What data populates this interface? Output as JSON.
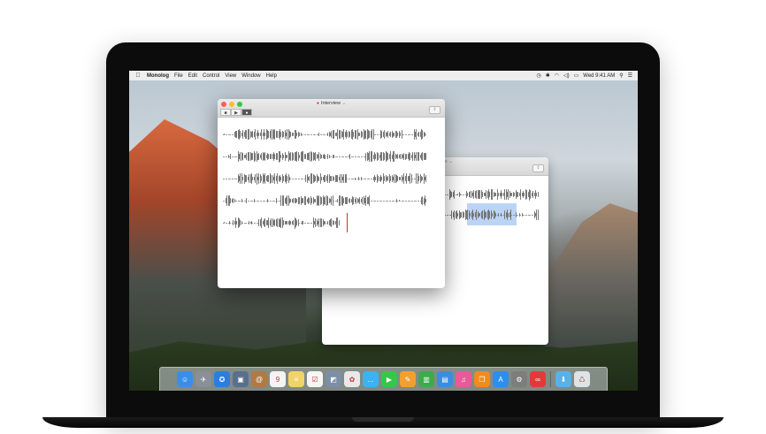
{
  "menubar": {
    "apple_icon": "apple-logo-icon",
    "app_name": "Monolog",
    "items": [
      "File",
      "Edit",
      "Control",
      "Window",
      "Help"
    ],
    "status_icons": [
      "time-machine-icon",
      "bluetooth-icon",
      "wifi-icon",
      "volume-icon",
      "battery-icon"
    ],
    "clock": "Wed 9:41 AM",
    "spotlight_icon": "search-icon",
    "notification_icon": "list-icon"
  },
  "front_window": {
    "title": "Interview",
    "title_suffix": "⌄",
    "recording_indicator": "●",
    "controls": [
      {
        "name": "stop",
        "glyph": "■"
      },
      {
        "name": "play",
        "glyph": "▶"
      },
      {
        "name": "record",
        "glyph": "●"
      }
    ],
    "share_glyph": "⇪",
    "rows": 5
  },
  "back_window": {
    "title_fragment": "ce ⌄",
    "share_glyph": "⇪"
  },
  "dock": {
    "items": [
      {
        "name": "finder",
        "color": "#3a8ee6",
        "glyph": "☺"
      },
      {
        "name": "launchpad",
        "color": "#8a8f99",
        "glyph": "✈"
      },
      {
        "name": "safari",
        "color": "#2b7de0",
        "glyph": "✪"
      },
      {
        "name": "photo-booth",
        "color": "#5a6f8c",
        "glyph": "▣"
      },
      {
        "name": "contacts",
        "color": "#b07a45",
        "glyph": "@"
      },
      {
        "name": "calendar",
        "color": "#f4f4f4",
        "glyph": "9"
      },
      {
        "name": "notes",
        "color": "#f2d36b",
        "glyph": "≡"
      },
      {
        "name": "reminders",
        "color": "#f6f6f6",
        "glyph": "☑"
      },
      {
        "name": "preview",
        "color": "#7c8fa7",
        "glyph": "◩"
      },
      {
        "name": "photos",
        "color": "#e9e9e9",
        "glyph": "✿"
      },
      {
        "name": "messages",
        "color": "#3bb3f2",
        "glyph": "…"
      },
      {
        "name": "facetime",
        "color": "#35c64a",
        "glyph": "▶"
      },
      {
        "name": "pages",
        "color": "#f0a032",
        "glyph": "✎"
      },
      {
        "name": "numbers",
        "color": "#3eaa4a",
        "glyph": "▥"
      },
      {
        "name": "keynote",
        "color": "#3a8de0",
        "glyph": "▤"
      },
      {
        "name": "itunes",
        "color": "#e95a9a",
        "glyph": "♫"
      },
      {
        "name": "ibooks",
        "color": "#f28a1e",
        "glyph": "❐"
      },
      {
        "name": "app-store",
        "color": "#2a8ff0",
        "glyph": "A"
      },
      {
        "name": "system-preferences",
        "color": "#7d7d7d",
        "glyph": "⚙"
      },
      {
        "name": "monolog",
        "color": "#e23a3a",
        "glyph": "∞"
      },
      {
        "name": "separator",
        "color": "",
        "glyph": ""
      },
      {
        "name": "downloads",
        "color": "#5ab0e8",
        "glyph": "⬇"
      },
      {
        "name": "trash",
        "color": "#dfe3e6",
        "glyph": "♺"
      }
    ]
  },
  "colors": {
    "waveform": "#777777",
    "playhead": "#e0262d",
    "selection": "#78aaeb"
  }
}
